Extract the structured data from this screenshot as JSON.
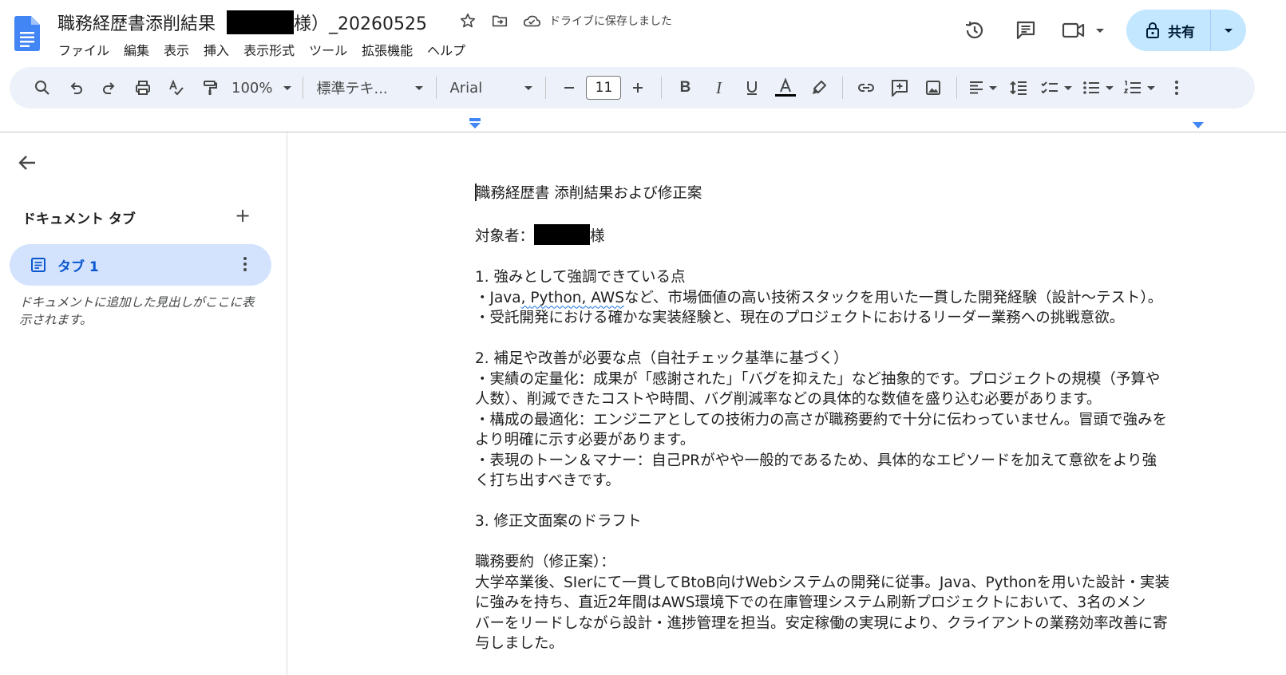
{
  "header": {
    "title_prefix": "職務経歴書添削結果",
    "title_suffix": "様）_20260525",
    "saved_status": "ドライブに保存しました",
    "share_label": "共有"
  },
  "menu": [
    "ファイル",
    "編集",
    "表示",
    "挿入",
    "表示形式",
    "ツール",
    "拡張機能",
    "ヘルプ"
  ],
  "toolbar": {
    "zoom": "100%",
    "paragraph_style": "標準テキ...",
    "font": "Arial",
    "font_size": "11"
  },
  "sidebar": {
    "heading": "ドキュメント タブ",
    "tab_name": "タブ 1",
    "hint": "ドキュメントに追加した見出しがここに表示されます。"
  },
  "document": {
    "title": "職務経歴書 添削結果および修正案",
    "target_prefix": "対象者：",
    "target_suffix": "様",
    "s1_heading": "1. 強みとして強調できている点",
    "s1_b1_pre": "・",
    "s1_b1_java": "Java",
    "s1_b1_sep1": ", ",
    "s1_b1_python": "Python",
    "s1_b1_sep2": ", ",
    "s1_b1_aws": "AWS",
    "s1_b1_rest": "など、市場価値の高い技術スタックを用いた一貫した開発経験（設計〜テスト）。",
    "s1_b2": "・受託開発における確かな実装経験と、現在のプロジェクトにおけるリーダー業務への挑戦意欲。",
    "s2_heading": "2. 補足や改善が必要な点（自社チェック基準に基づく）",
    "s2_b1a": "・実績の定量化：成果が「感謝された」「バグを抑えた」など抽象的です。プロジェクトの規模（予算や",
    "s2_b1b": "人数）、削減できたコストや時間、バグ削減率などの具体的な数値を盛り込む必要があります。",
    "s2_b2a": "・構成の最適化：エンジニアとしての技術力の高さが職務要約で十分に伝わっていません。冒頭で強みを",
    "s2_b2b": "より明確に示す必要があります。",
    "s2_b3a": "・表現のトーン＆マナー：自己PRがやや一般的であるため、具体的なエピソードを加えて意欲をより強",
    "s2_b3b": "く打ち出すべきです。",
    "s3_heading": "3. 修正文面案のドラフト",
    "summary_heading": "職務要約（修正案）：",
    "summary_l1": "大学卒業後、SIerにて一貫してBtoB向けWebシステムの開発に従事。Java、Pythonを用いた設計・実装",
    "summary_l2": "に強みを持ち、直近2年間はAWS環境下での在庫管理システム刷新プロジェクトにおいて、3名のメン",
    "summary_l3": "バーをリードしながら設計・進捗管理を担当。安定稼働の実現により、クライアントの業務効率改善に寄",
    "summary_l4": "与しました。"
  },
  "colors": {
    "accent": "#0b57d0",
    "share_bg": "#c2e7ff",
    "toolbar_bg": "#edf2fa",
    "tab_bg": "#d3e3fd",
    "docs_blue": "#4285f4"
  }
}
